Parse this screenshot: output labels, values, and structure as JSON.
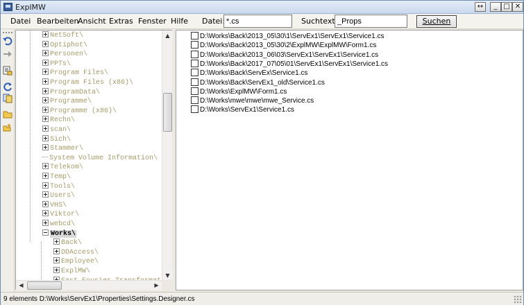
{
  "window": {
    "title": "ExplMW"
  },
  "menu": {
    "items": [
      "Datei",
      "Bearbeiten",
      "Ansicht",
      "Extras",
      "Fenster",
      "Hilfe"
    ]
  },
  "toolbar": {
    "file_label": "Datei:",
    "file_value": "*.cs",
    "search_label": "Suchtext:",
    "search_value": "_Props",
    "search_button": "Suchen"
  },
  "tree": {
    "items": [
      {
        "label": "NetSoft\\",
        "expander": "plus",
        "level": 0
      },
      {
        "label": "Optiphot\\",
        "expander": "plus",
        "level": 0
      },
      {
        "label": "Personen\\",
        "expander": "plus",
        "level": 0
      },
      {
        "label": "PPTs\\",
        "expander": "plus",
        "level": 0
      },
      {
        "label": "Program Files\\",
        "expander": "plus",
        "level": 0
      },
      {
        "label": "Program Files (x86)\\",
        "expander": "plus",
        "level": 0
      },
      {
        "label": "ProgramData\\",
        "expander": "plus",
        "level": 0
      },
      {
        "label": "Programme\\",
        "expander": "plus",
        "level": 0
      },
      {
        "label": "Programme (x86)\\",
        "expander": "plus",
        "level": 0
      },
      {
        "label": "Rechn\\",
        "expander": "plus",
        "level": 0
      },
      {
        "label": "scan\\",
        "expander": "plus",
        "level": 0
      },
      {
        "label": "Sich\\",
        "expander": "plus",
        "level": 0
      },
      {
        "label": "Stammer\\",
        "expander": "plus",
        "level": 0
      },
      {
        "label": "System Volume Information\\",
        "expander": "none",
        "level": 0
      },
      {
        "label": "Telekom\\",
        "expander": "plus",
        "level": 0
      },
      {
        "label": "Temp\\",
        "expander": "plus",
        "level": 0
      },
      {
        "label": "Tools\\",
        "expander": "plus",
        "level": 0
      },
      {
        "label": "Users\\",
        "expander": "plus",
        "level": 0
      },
      {
        "label": "VHS\\",
        "expander": "plus",
        "level": 0
      },
      {
        "label": "Viktor\\",
        "expander": "plus",
        "level": 0
      },
      {
        "label": "webcd\\",
        "expander": "plus",
        "level": 0
      },
      {
        "label": "Works\\",
        "expander": "minus",
        "level": 0,
        "selected": true
      },
      {
        "label": "Back\\",
        "expander": "plus",
        "level": 1
      },
      {
        "label": "DDAccess\\",
        "expander": "plus",
        "level": 1
      },
      {
        "label": "Employee\\",
        "expander": "plus",
        "level": 1
      },
      {
        "label": "ExplMW\\",
        "expander": "plus",
        "level": 1
      },
      {
        "label": "Fast Fourier Transformat",
        "expander": "plus",
        "level": 1
      }
    ]
  },
  "results": {
    "items": [
      "D:\\Works\\Back\\2013_05\\30\\1\\ServEx1\\ServEx1\\Service1.cs",
      "D:\\Works\\Back\\2013_05\\30\\2\\ExplMW\\ExplMW\\Form1.cs",
      "D:\\Works\\Back\\2013_06\\03\\ServEx1\\ServEx1\\Service1.cs",
      "D:\\Works\\Back\\2017_07\\05\\01\\ServEx1\\ServEx1\\Service1.cs",
      "D:\\Works\\Back\\ServEx\\Service1.cs",
      "D:\\Works\\Back\\ServEx1_old\\Service1.cs",
      "D:\\Works\\ExplMW\\Form1.cs",
      "D:\\Works\\mwe\\mwe\\mwe_Service.cs",
      "D:\\Works\\ServEx1\\Service1.cs"
    ]
  },
  "status": {
    "text": "9 elements D:\\Works\\ServEx1\\Properties\\Settings.Designer.cs"
  },
  "icons": {
    "undo": "undo-icon",
    "redo": "redo-icon",
    "properties": "properties-icon",
    "refresh": "refresh-icon",
    "copy": "copy-icon",
    "folder": "folder-icon",
    "new_folder": "new-folder-icon"
  },
  "colors": {
    "tree_text": "#a59a68",
    "titlebar": "#c9d9ee",
    "selection": "#d9d9d9"
  }
}
